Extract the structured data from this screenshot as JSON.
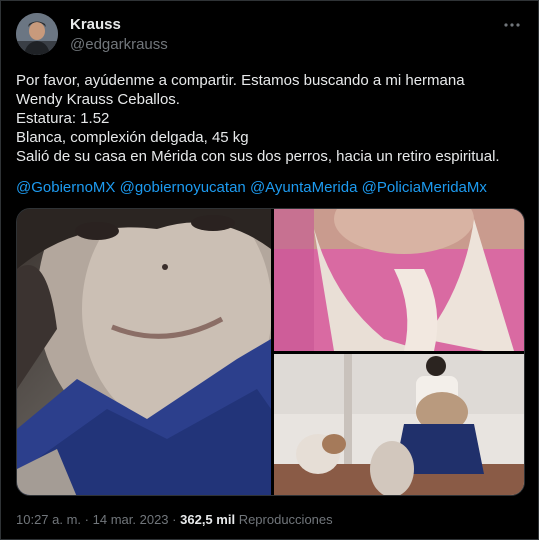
{
  "author": {
    "name": "Krauss",
    "handle": "@edgarkrauss",
    "avatar_icon": "user-avatar"
  },
  "more_icon": "ellipsis-icon",
  "tweet": {
    "lines": [
      "Por favor, ayúdenme a compartir. Estamos buscando a mi hermana",
      "Wendy Krauss Ceballos.",
      "Estatura: 1.52",
      "Blanca, complexión delgada, 45 kg",
      "Salió de su casa en Mérida con sus dos perros, hacia un retiro espiritual."
    ],
    "mentions": [
      "@GobiernoMX",
      "@gobiernoyucatan",
      "@AyuntaMerida",
      "@PoliciaMeridaMx"
    ]
  },
  "meta": {
    "time": "10:27 a. m.",
    "sep1": "·",
    "date": "14 mar. 2023",
    "sep2": "·",
    "views": "362,5 mil",
    "views_label": "Reproducciones"
  },
  "colors": {
    "background": "#000000",
    "text": "#e7e9ea",
    "secondary": "#71767b",
    "link": "#1d9bf0"
  }
}
